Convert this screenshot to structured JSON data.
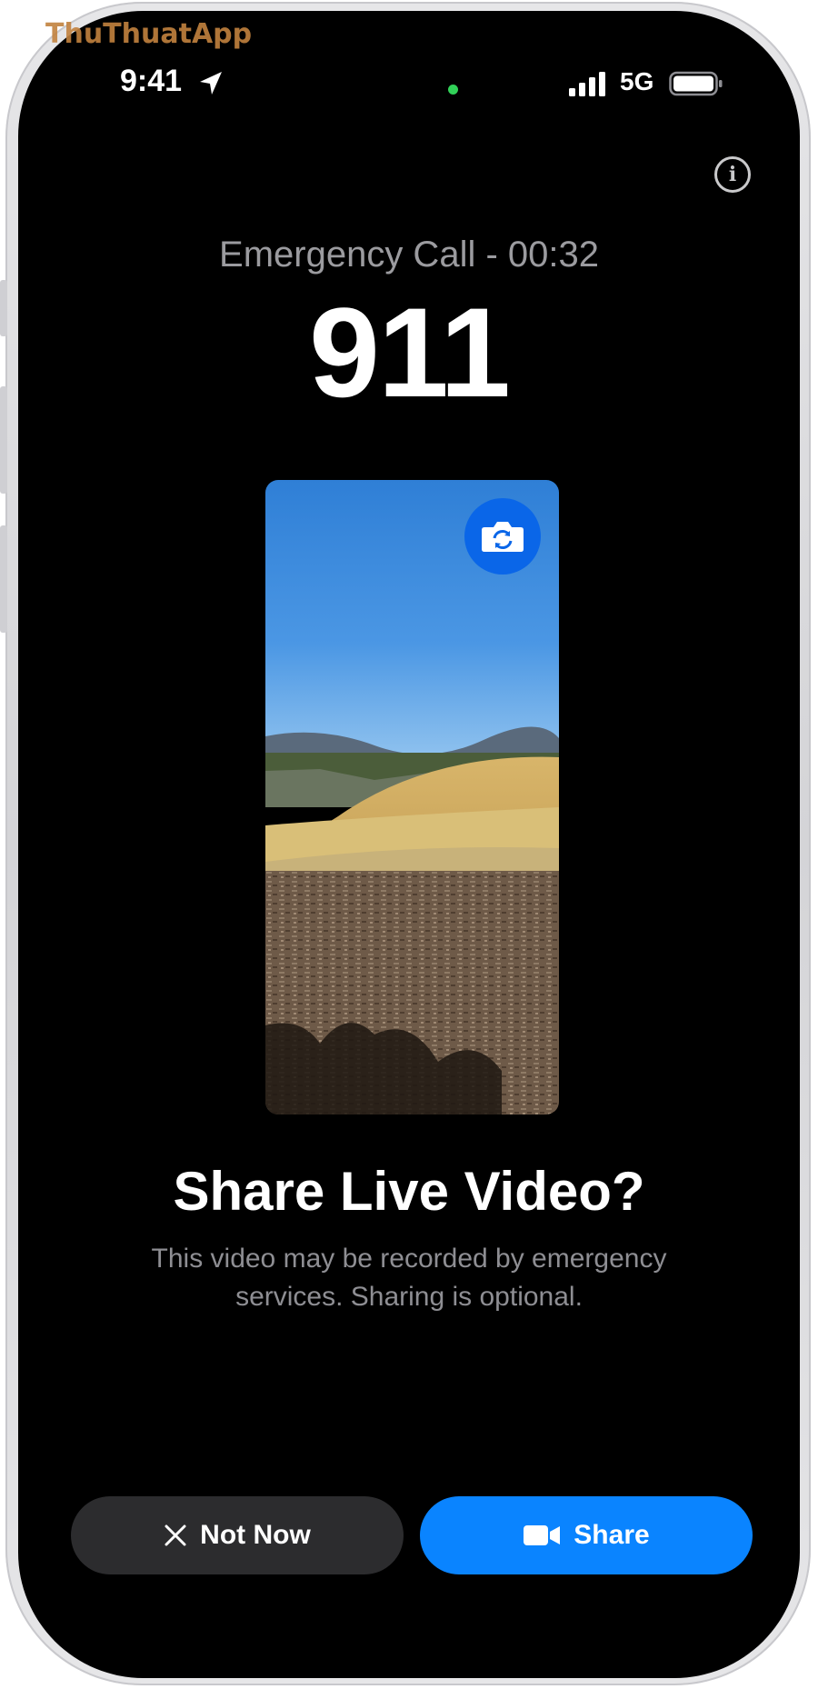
{
  "watermark": "ThuThuatApp",
  "status_bar": {
    "time": "9:41",
    "network": "5G",
    "icons": [
      "location-arrow-icon",
      "privacy-indicator-dot",
      "cellular-signal-icon",
      "battery-icon"
    ],
    "privacy_dot_color": "#31d158"
  },
  "header": {
    "info_icon": "info-icon",
    "info_glyph": "i"
  },
  "call": {
    "status": "Emergency Call - 00:32",
    "number": "911"
  },
  "video_preview": {
    "flip_icon": "flip-camera-icon"
  },
  "prompt": {
    "title": "Share Live Video?",
    "body": "This video may be recorded by emergency services. Sharing is optional."
  },
  "actions": {
    "not_now": {
      "label": "Not Now",
      "icon": "close-x-icon"
    },
    "share": {
      "label": "Share",
      "icon": "video-camera-icon"
    }
  },
  "colors": {
    "background": "#000000",
    "secondary_button": "#2c2c2e",
    "primary_button": "#0a84ff",
    "flip_button": "#0a66e8",
    "secondary_text": "#8e8e93"
  }
}
